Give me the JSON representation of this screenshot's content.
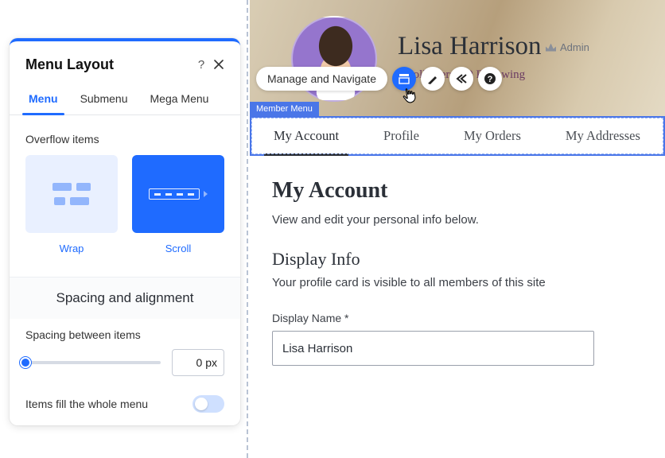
{
  "panel": {
    "title": "Menu Layout",
    "tabs": [
      "Menu",
      "Submenu",
      "Mega Menu"
    ],
    "active_tab_index": 0,
    "overflow": {
      "label": "Overflow items",
      "options": [
        "Wrap",
        "Scroll"
      ],
      "selected_index": 1
    },
    "spacing_header": "Spacing and alignment",
    "spacing": {
      "label": "Spacing between items",
      "value": "0",
      "unit": "px"
    },
    "fill": {
      "label": "Items fill the whole menu",
      "enabled": false
    }
  },
  "toolbar": {
    "label": "Manage and Navigate"
  },
  "user": {
    "name": "Lisa Harrison",
    "role": "Admin",
    "followers": "0 Followers",
    "following": "0 Following"
  },
  "member_menu": {
    "chip": "Member Menu",
    "tabs": [
      "My Account",
      "Profile",
      "My Orders",
      "My Addresses"
    ],
    "active_tab_index": 0
  },
  "account": {
    "heading": "My Account",
    "intro": "View and edit your personal info below.",
    "section_heading": "Display Info",
    "section_sub": "Your profile card is visible to all members of this site",
    "display_name_label": "Display Name *",
    "display_name_value": "Lisa Harrison"
  }
}
